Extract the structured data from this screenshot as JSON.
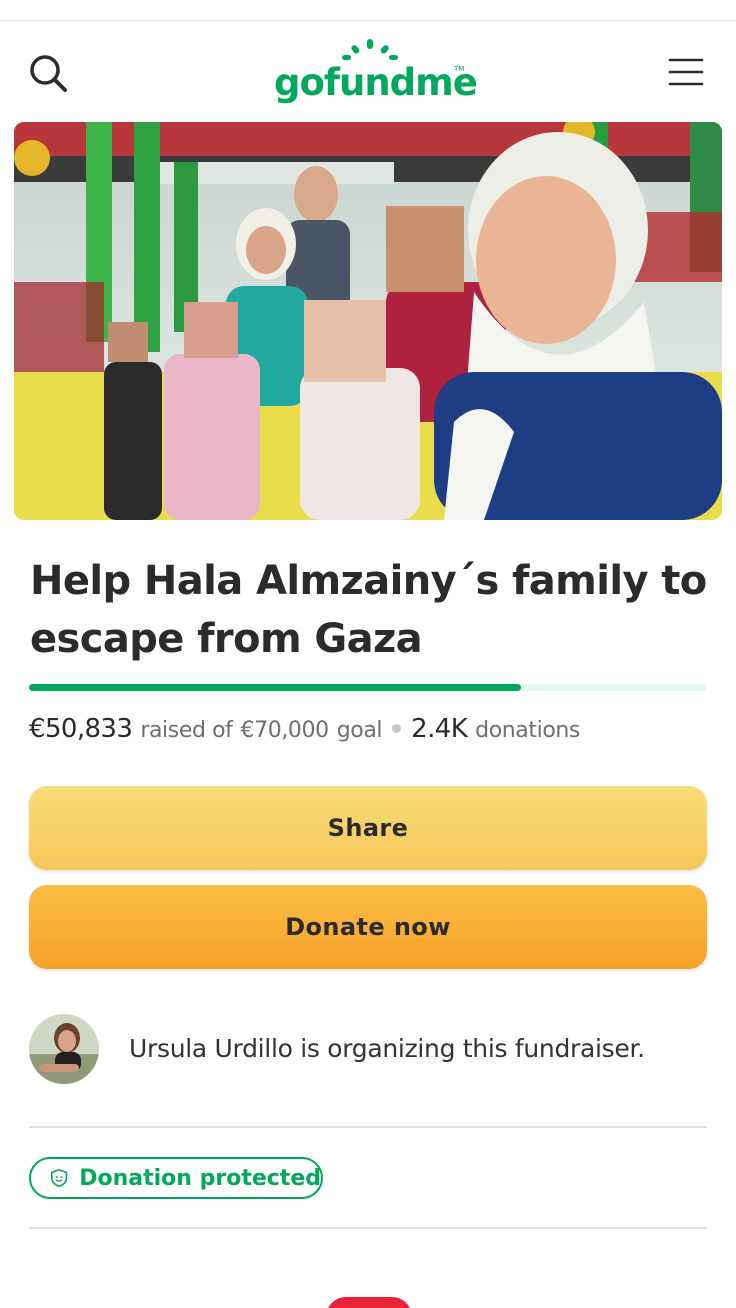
{
  "header": {
    "logo_text": "gofundme",
    "logo_tm": "TM",
    "search_icon": "search-icon",
    "menu_icon": "hamburger-menu-icon"
  },
  "campaign": {
    "title": "Help Hala Almzainy´s family to escape from Gaza",
    "hero_image": "family-selfie-photo",
    "raised": "€50,833",
    "raised_of": "raised of",
    "goal": "€70,000",
    "goal_suffix": "goal",
    "donations_count": "2.4K",
    "donations_label": "donations",
    "progress_fraction": 0.726
  },
  "actions": {
    "share_label": "Share",
    "donate_label": "Donate now"
  },
  "organizer": {
    "text": "Ursula Urdillo is organizing this fundraiser."
  },
  "protection": {
    "label": "Donation protected",
    "icon": "shield-icon"
  },
  "colors": {
    "brand_green": "#02a95c",
    "share_yellow": "#f5c759",
    "donate_orange": "#f5a128"
  }
}
